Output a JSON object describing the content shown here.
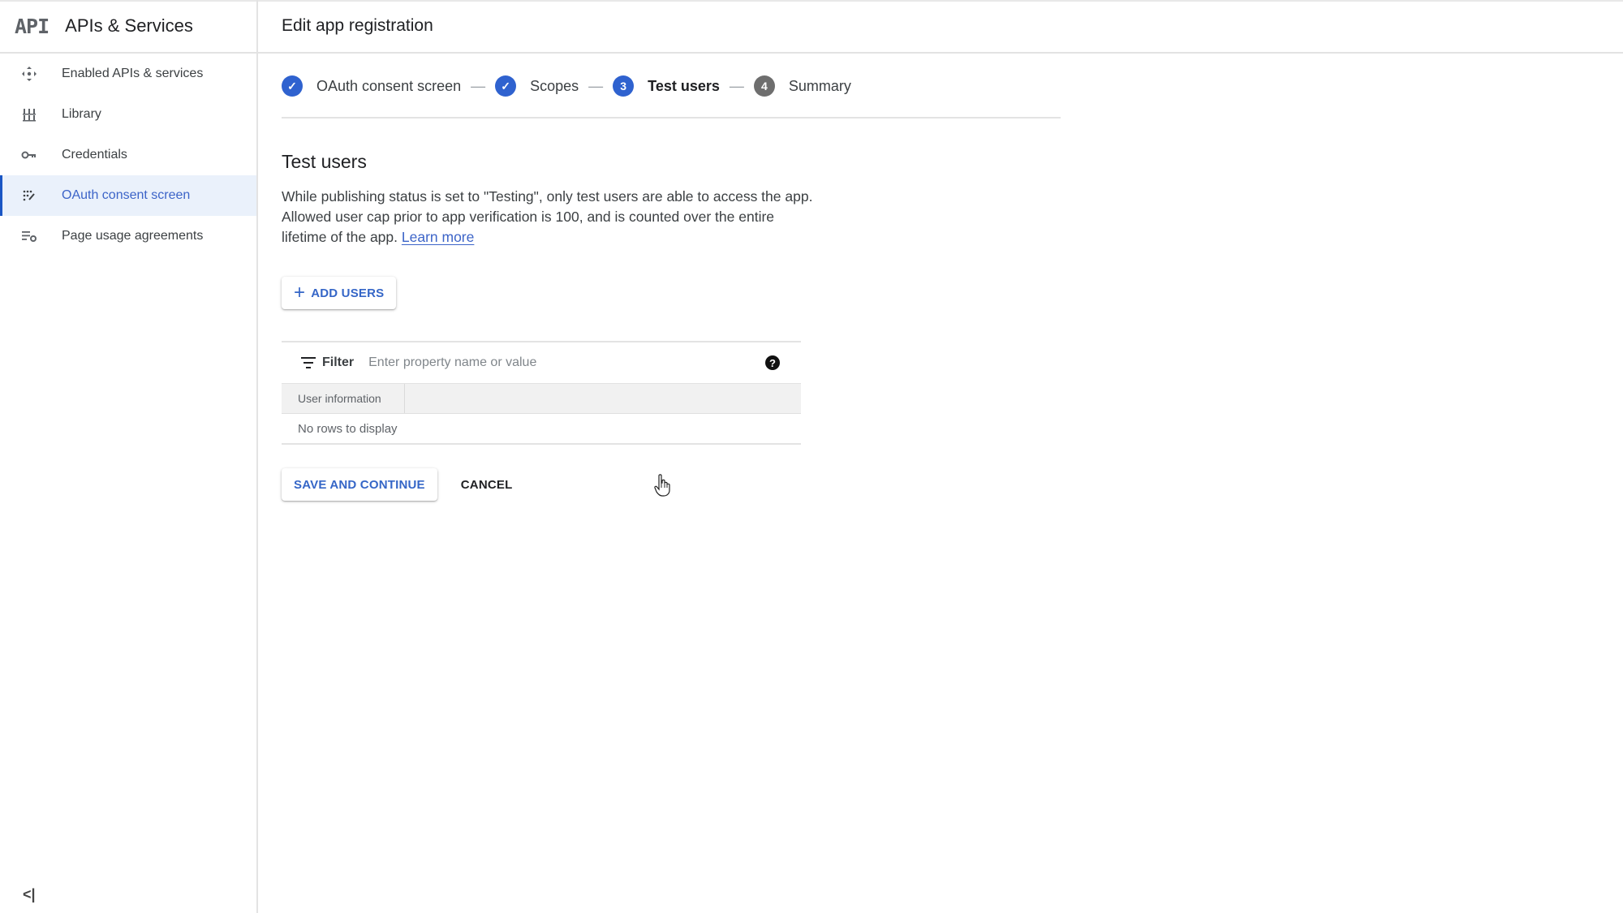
{
  "sidebar": {
    "logo": "API",
    "title": "APIs & Services",
    "items": [
      {
        "label": "Enabled APIs & services",
        "icon": "enabled-apis-icon",
        "active": false
      },
      {
        "label": "Library",
        "icon": "library-icon",
        "active": false
      },
      {
        "label": "Credentials",
        "icon": "key-icon",
        "active": false
      },
      {
        "label": "OAuth consent screen",
        "icon": "oauth-consent-icon",
        "active": true
      },
      {
        "label": "Page usage agreements",
        "icon": "page-usage-settings-icon",
        "active": false
      }
    ],
    "collapse_glyph": "<|"
  },
  "header": {
    "title": "Edit app registration"
  },
  "stepper": {
    "steps": [
      {
        "label": "OAuth consent screen",
        "state": "done",
        "marker": "✓"
      },
      {
        "label": "Scopes",
        "state": "done",
        "marker": "✓"
      },
      {
        "label": "Test users",
        "state": "current",
        "marker": "3"
      },
      {
        "label": "Summary",
        "state": "todo",
        "marker": "4"
      }
    ],
    "separator": "—"
  },
  "section": {
    "title": "Test users",
    "description": "While publishing status is set to \"Testing\", only test users are able to access the app. Allowed user cap prior to app verification is 100, and is counted over the entire lifetime of the app.",
    "learn_more": "Learn more",
    "add_users_label": "ADD USERS",
    "add_users_glyph": "+"
  },
  "table": {
    "filter_label": "Filter",
    "filter_placeholder": "Enter property name or value",
    "filter_value": "",
    "help_glyph": "?",
    "columns": [
      "User information"
    ],
    "empty_message": "No rows to display"
  },
  "actions": {
    "save_label": "SAVE AND CONTINUE",
    "cancel_label": "CANCEL"
  },
  "colors": {
    "accent": "#3566c7",
    "active_nav_bg": "#eaf1fb",
    "step_pending": "#6e6e6e"
  }
}
